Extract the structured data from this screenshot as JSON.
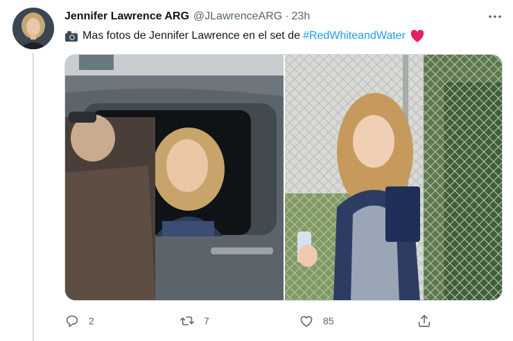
{
  "tweet": {
    "author": {
      "display_name": "Jennifer Lawrence ARG",
      "handle": "@JLawrenceARG",
      "separator": "·",
      "timestamp": "23h"
    },
    "text": {
      "prefix_icon": "camera-with-flash-emoji",
      "body": "Mas fotos de Jennifer Lawrence en el set de",
      "hashtag": "#RedWhiteandWater",
      "suffix_icon": "red-heart-emoji"
    },
    "media": [
      {
        "icon": "photo-truck-window"
      },
      {
        "icon": "photo-chainlink-fence"
      }
    ],
    "actions": {
      "reply_count": "2",
      "retweet_count": "7",
      "like_count": "85"
    },
    "colors": {
      "hashtag": "#1d9bf0",
      "secondary_text": "#536471",
      "heart": "#e0245e"
    }
  }
}
